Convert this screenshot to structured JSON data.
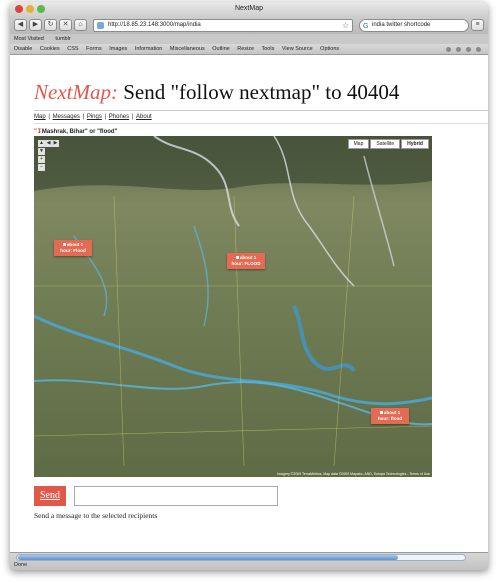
{
  "browser": {
    "window_title": "NextMap",
    "url": "http://18.85.23.148:3000/map/india",
    "search_query": "india twitter shortcode",
    "bookmarks": [
      "Most Visited",
      "tumblr"
    ],
    "webdev_toolbar": [
      "Disable",
      "Cookies",
      "CSS",
      "Forms",
      "Images",
      "Information",
      "Miscellaneous",
      "Outline",
      "Resize",
      "Tools",
      "View Source",
      "Options"
    ],
    "status": "Done"
  },
  "page": {
    "brand": "NextMap:",
    "heading_rest": " Send \"follow nextmap\" to 40404",
    "nav": [
      "Map",
      "Messages",
      "Pings",
      "Phones",
      "About"
    ],
    "query_text": "Mashrak, Bihar\" or \"flood\"",
    "send_label": "Send",
    "send_hint": "Send a message to the selected recipients"
  },
  "map": {
    "types": [
      "Map",
      "Satellite",
      "Hybrid"
    ],
    "active_type": "Hybrid",
    "markers": [
      {
        "line1": "about 1",
        "line2": "hour: Flood"
      },
      {
        "line1": "about 1",
        "line2": "hour: FLOOD"
      },
      {
        "line1": "about 1",
        "line2": "hour: flood"
      }
    ],
    "footer": "Imagery ©2009 TerraMetrics, Map data ©2009 Mapabc, AND, Europa Technologies - Terms of Use"
  },
  "colors": {
    "accent": "#e0584a",
    "marker": "#e36a53"
  }
}
